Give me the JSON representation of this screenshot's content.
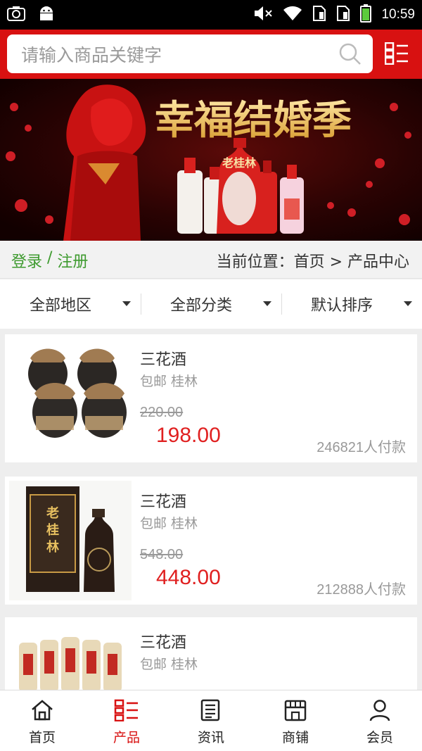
{
  "status_bar": {
    "time": "10:59",
    "icons": [
      "screenshot-icon",
      "android-icon",
      "mute-icon",
      "wifi-icon",
      "sim1-icon",
      "sim2-icon",
      "battery-icon"
    ]
  },
  "search": {
    "placeholder": "请输入商品关键字"
  },
  "banner": {
    "headline": "幸福结婚季",
    "brand_text": "老桂林"
  },
  "location_bar": {
    "login": "登录",
    "separator": " / ",
    "register": "注册",
    "location": "当前位置：首页 > 产品中心"
  },
  "filters": [
    {
      "label": "全部地区"
    },
    {
      "label": "全部分类"
    },
    {
      "label": "默认排序"
    }
  ],
  "products": [
    {
      "name": "三花酒",
      "meta": "包邮 桂林",
      "old_price": "220.00",
      "price": "198.00",
      "paid": "246821人付款"
    },
    {
      "name": "三花酒",
      "meta": "包邮 桂林",
      "old_price": "548.00",
      "price": "448.00",
      "paid": "212888人付款"
    },
    {
      "name": "三花酒",
      "meta": "包邮 桂林",
      "old_price": "",
      "price": "",
      "paid": ""
    }
  ],
  "bottom_nav": [
    {
      "label": "首页",
      "icon": "home-icon",
      "active": false
    },
    {
      "label": "产品",
      "icon": "product-list-icon",
      "active": true
    },
    {
      "label": "资讯",
      "icon": "news-icon",
      "active": false
    },
    {
      "label": "商铺",
      "icon": "shop-icon",
      "active": false
    },
    {
      "label": "会员",
      "icon": "member-icon",
      "active": false
    }
  ],
  "colors": {
    "brand_red": "#d81111",
    "price_red": "#e02020",
    "login_green": "#3d9a2e"
  }
}
